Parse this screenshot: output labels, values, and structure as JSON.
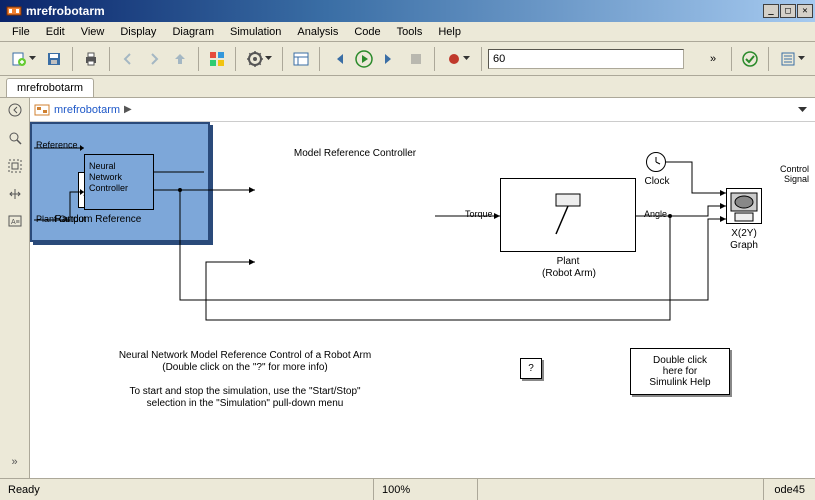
{
  "window": {
    "title": "mrefrobotarm"
  },
  "menu": {
    "items": [
      "File",
      "Edit",
      "View",
      "Display",
      "Diagram",
      "Simulation",
      "Analysis",
      "Code",
      "Tools",
      "Help"
    ]
  },
  "toolbar": {
    "simtime": "60"
  },
  "tabs": {
    "active": "mrefrobotarm"
  },
  "breadcrumb": {
    "path0": "mrefrobotarm"
  },
  "blocks": {
    "random_ref_label": "Random Reference",
    "controller_title": "Model Reference Controller",
    "controller_inner_l1": "Neural",
    "controller_inner_l2": "Network",
    "controller_inner_l3": "Controller",
    "controller_port_ref": "Reference",
    "controller_port_plant": "Plant Output",
    "controller_port_out": "Control",
    "controller_port_out2": "Signal",
    "plant_label": "Plant",
    "plant_label2": "(Robot Arm)",
    "plant_port_in": "Torque",
    "plant_port_out": "Angle",
    "clock_label": "Clock",
    "graph_label1": "X(2Y)",
    "graph_label2": "Graph"
  },
  "info": {
    "l1": "Neural Network Model Reference Control of a Robot Arm",
    "l2": "(Double click on the \"?\" for more info)",
    "l3": "To start and stop the simulation, use the \"Start/Stop\"",
    "l4": "selection in the \"Simulation\" pull-down menu",
    "qmark": "?",
    "help1": "Double click",
    "help2": "here for",
    "help3": "Simulink Help"
  },
  "status": {
    "ready": "Ready",
    "zoom": "100%",
    "solver": "ode45"
  }
}
